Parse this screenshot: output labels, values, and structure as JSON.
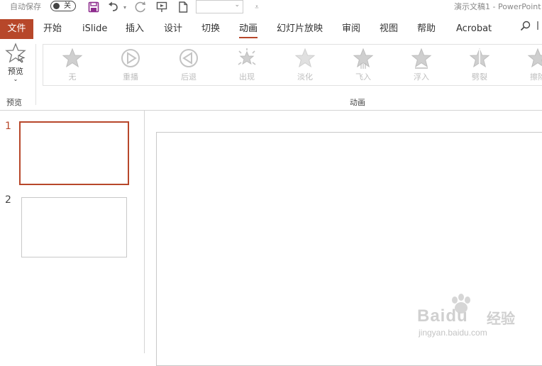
{
  "titlebar": {
    "autosave_label": "自动保存",
    "autosave_state": "关",
    "document_title": "演示文稿1 - PowerPoint"
  },
  "tabs": [
    {
      "label": "文件",
      "icon": null
    },
    {
      "label": "开始"
    },
    {
      "label": "iSlide"
    },
    {
      "label": "插入"
    },
    {
      "label": "设计"
    },
    {
      "label": "切换"
    },
    {
      "label": "动画",
      "active": true
    },
    {
      "label": "幻灯片放映"
    },
    {
      "label": "审阅"
    },
    {
      "label": "视图"
    },
    {
      "label": "帮助"
    },
    {
      "label": "Acrobat"
    }
  ],
  "ribbon": {
    "preview_button_label": "预览",
    "preview_group_label": "预览",
    "animation_group_label": "动画",
    "animations": [
      "无",
      "重播",
      "后退",
      "出现",
      "淡化",
      "飞入",
      "浮入",
      "劈裂",
      "擦除"
    ]
  },
  "slides": [
    {
      "number": "1",
      "selected": true
    },
    {
      "number": "2",
      "selected": false
    }
  ],
  "colors": {
    "accent": "#b7472a",
    "disabled_icon": "#c8c8c8"
  },
  "watermark": {
    "brand": "Baidu",
    "product": "经验",
    "url": "jingyan.baidu.com"
  }
}
